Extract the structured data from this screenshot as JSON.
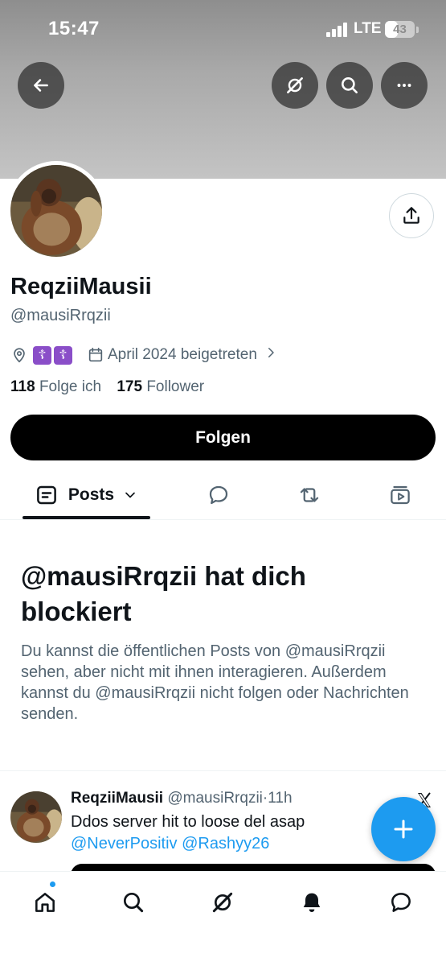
{
  "status_bar": {
    "time": "15:47",
    "network": "LTE",
    "battery": "43",
    "battery_level": 0.43
  },
  "header": {
    "back_icon": "arrow-left-icon",
    "grok_icon": "grok-icon",
    "search_icon": "search-icon",
    "more_icon": "more-icon",
    "share_icon": "share-icon"
  },
  "profile": {
    "display_name": "ReqziiMausii",
    "handle": "@mausiRrqzii",
    "location_emoji_1": "☦",
    "location_emoji_2": "☦",
    "joined": "April 2024 beigetreten",
    "following_count": "118",
    "following_label": "Folge ich",
    "followers_count": "175",
    "followers_label": "Follower",
    "follow_button": "Folgen"
  },
  "tabs": {
    "posts_label": "Posts",
    "icons": [
      "posts-icon",
      "reply-icon",
      "repost-icon",
      "media-icon"
    ]
  },
  "blocked": {
    "title": "@mausiRrqzii hat dich blockiert",
    "body": "Du kannst die öffentlichen Posts von @mausiRrqzii sehen, aber nicht mit ihnen interagieren. Außerdem kannst du @mausiRrqzii nicht folgen oder Nachrichten senden."
  },
  "tweet": {
    "name": "ReqziiMausii",
    "handle": "@mausiRrqzii",
    "separator": "·",
    "time": "11h",
    "text": "Ddos server hit to loose del asap",
    "mentions": "@NeverPositiv @Rashyy26"
  },
  "bottom_nav": {
    "items": [
      "home-icon",
      "search-icon",
      "grok-icon",
      "notifications-icon",
      "messages-icon"
    ]
  },
  "colors": {
    "accent": "#1d9bf0",
    "text": "#0f1419",
    "secondary": "#536471",
    "banner": "#a9a9a9"
  }
}
